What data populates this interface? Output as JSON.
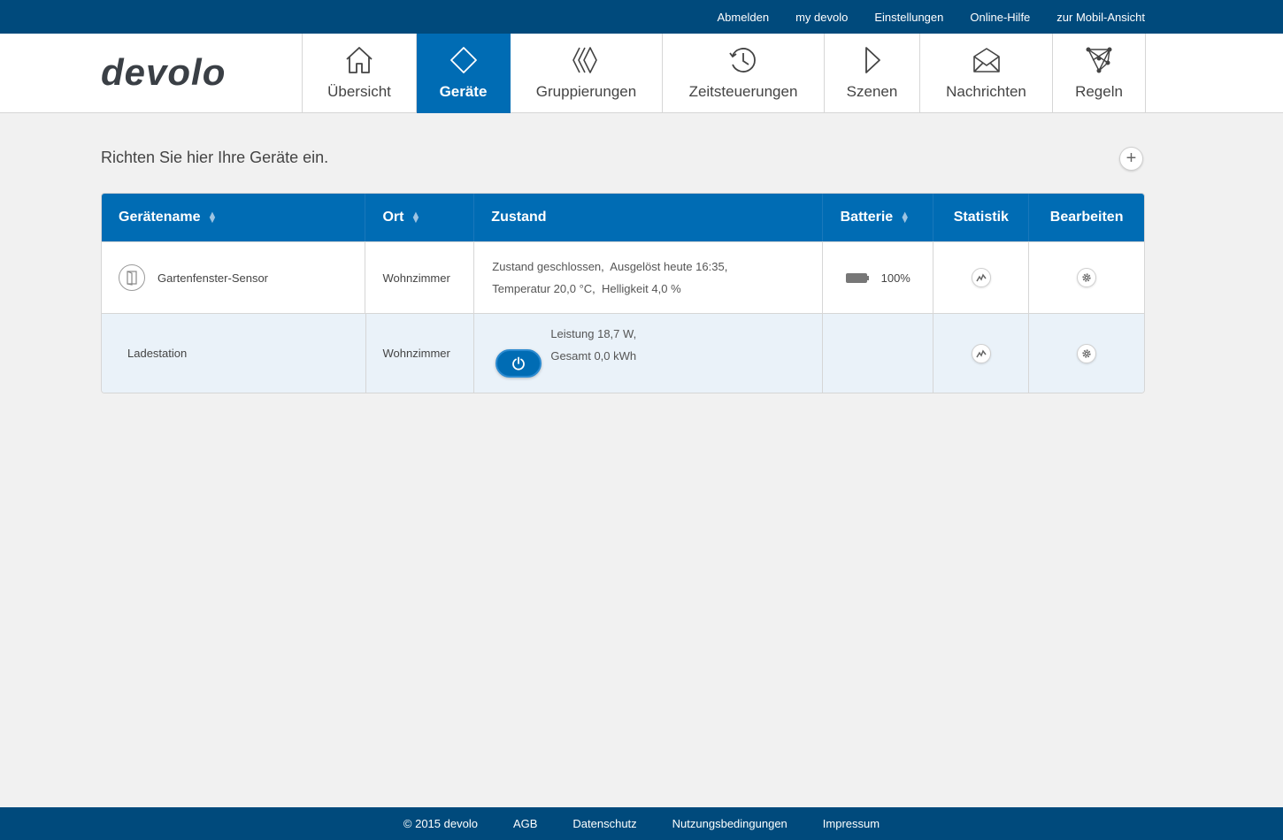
{
  "topbar": {
    "links": [
      "Abmelden",
      "my devolo",
      "Einstellungen",
      "Online-Hilfe",
      "zur Mobil-Ansicht"
    ]
  },
  "brand": {
    "logo_text": "devolo",
    "primary_color": "#006cb4",
    "dark_color": "#004a7c"
  },
  "nav": {
    "items": [
      {
        "label": "Übersicht",
        "icon": "home-icon"
      },
      {
        "label": "Geräte",
        "icon": "device-diamond-icon",
        "active": true
      },
      {
        "label": "Gruppierungen",
        "icon": "groups-icon"
      },
      {
        "label": "Zeitsteuerungen",
        "icon": "clock-icon"
      },
      {
        "label": "Szenen",
        "icon": "play-icon"
      },
      {
        "label": "Nachrichten",
        "icon": "envelope-icon"
      },
      {
        "label": "Regeln",
        "icon": "rules-network-icon"
      }
    ]
  },
  "main": {
    "intro": "Richten Sie hier Ihre Geräte ein.",
    "add_label": "+"
  },
  "table": {
    "headers": [
      "Gerätename",
      "Ort",
      "Zustand",
      "Batterie",
      "Statistik",
      "Bearbeiten"
    ],
    "rows": [
      {
        "name": "Gartenfenster-Sensor",
        "location": "Wohnzimmer",
        "state_line1_a": "Zustand",
        "state_line1_b": "geschlossen",
        "state_line1_c": "Ausgelöst",
        "state_line1_d": "heute 16:35",
        "state_line2_a": "Temperatur",
        "state_line2_b": "20,0 °C",
        "state_line2_c": "Helligkeit",
        "state_line2_d": "4,0 %",
        "battery": "100%"
      },
      {
        "name": "Ladestation",
        "location": "Wohnzimmer",
        "state_line1": "Leistung 18,7 W",
        "state_line2": "Gesamt 0,0 kWh",
        "battery": ""
      }
    ]
  },
  "footer": {
    "copyright": "© 2015 devolo",
    "links": [
      "AGB",
      "Datenschutz",
      "Nutzungsbedingungen",
      "Impressum"
    ]
  }
}
